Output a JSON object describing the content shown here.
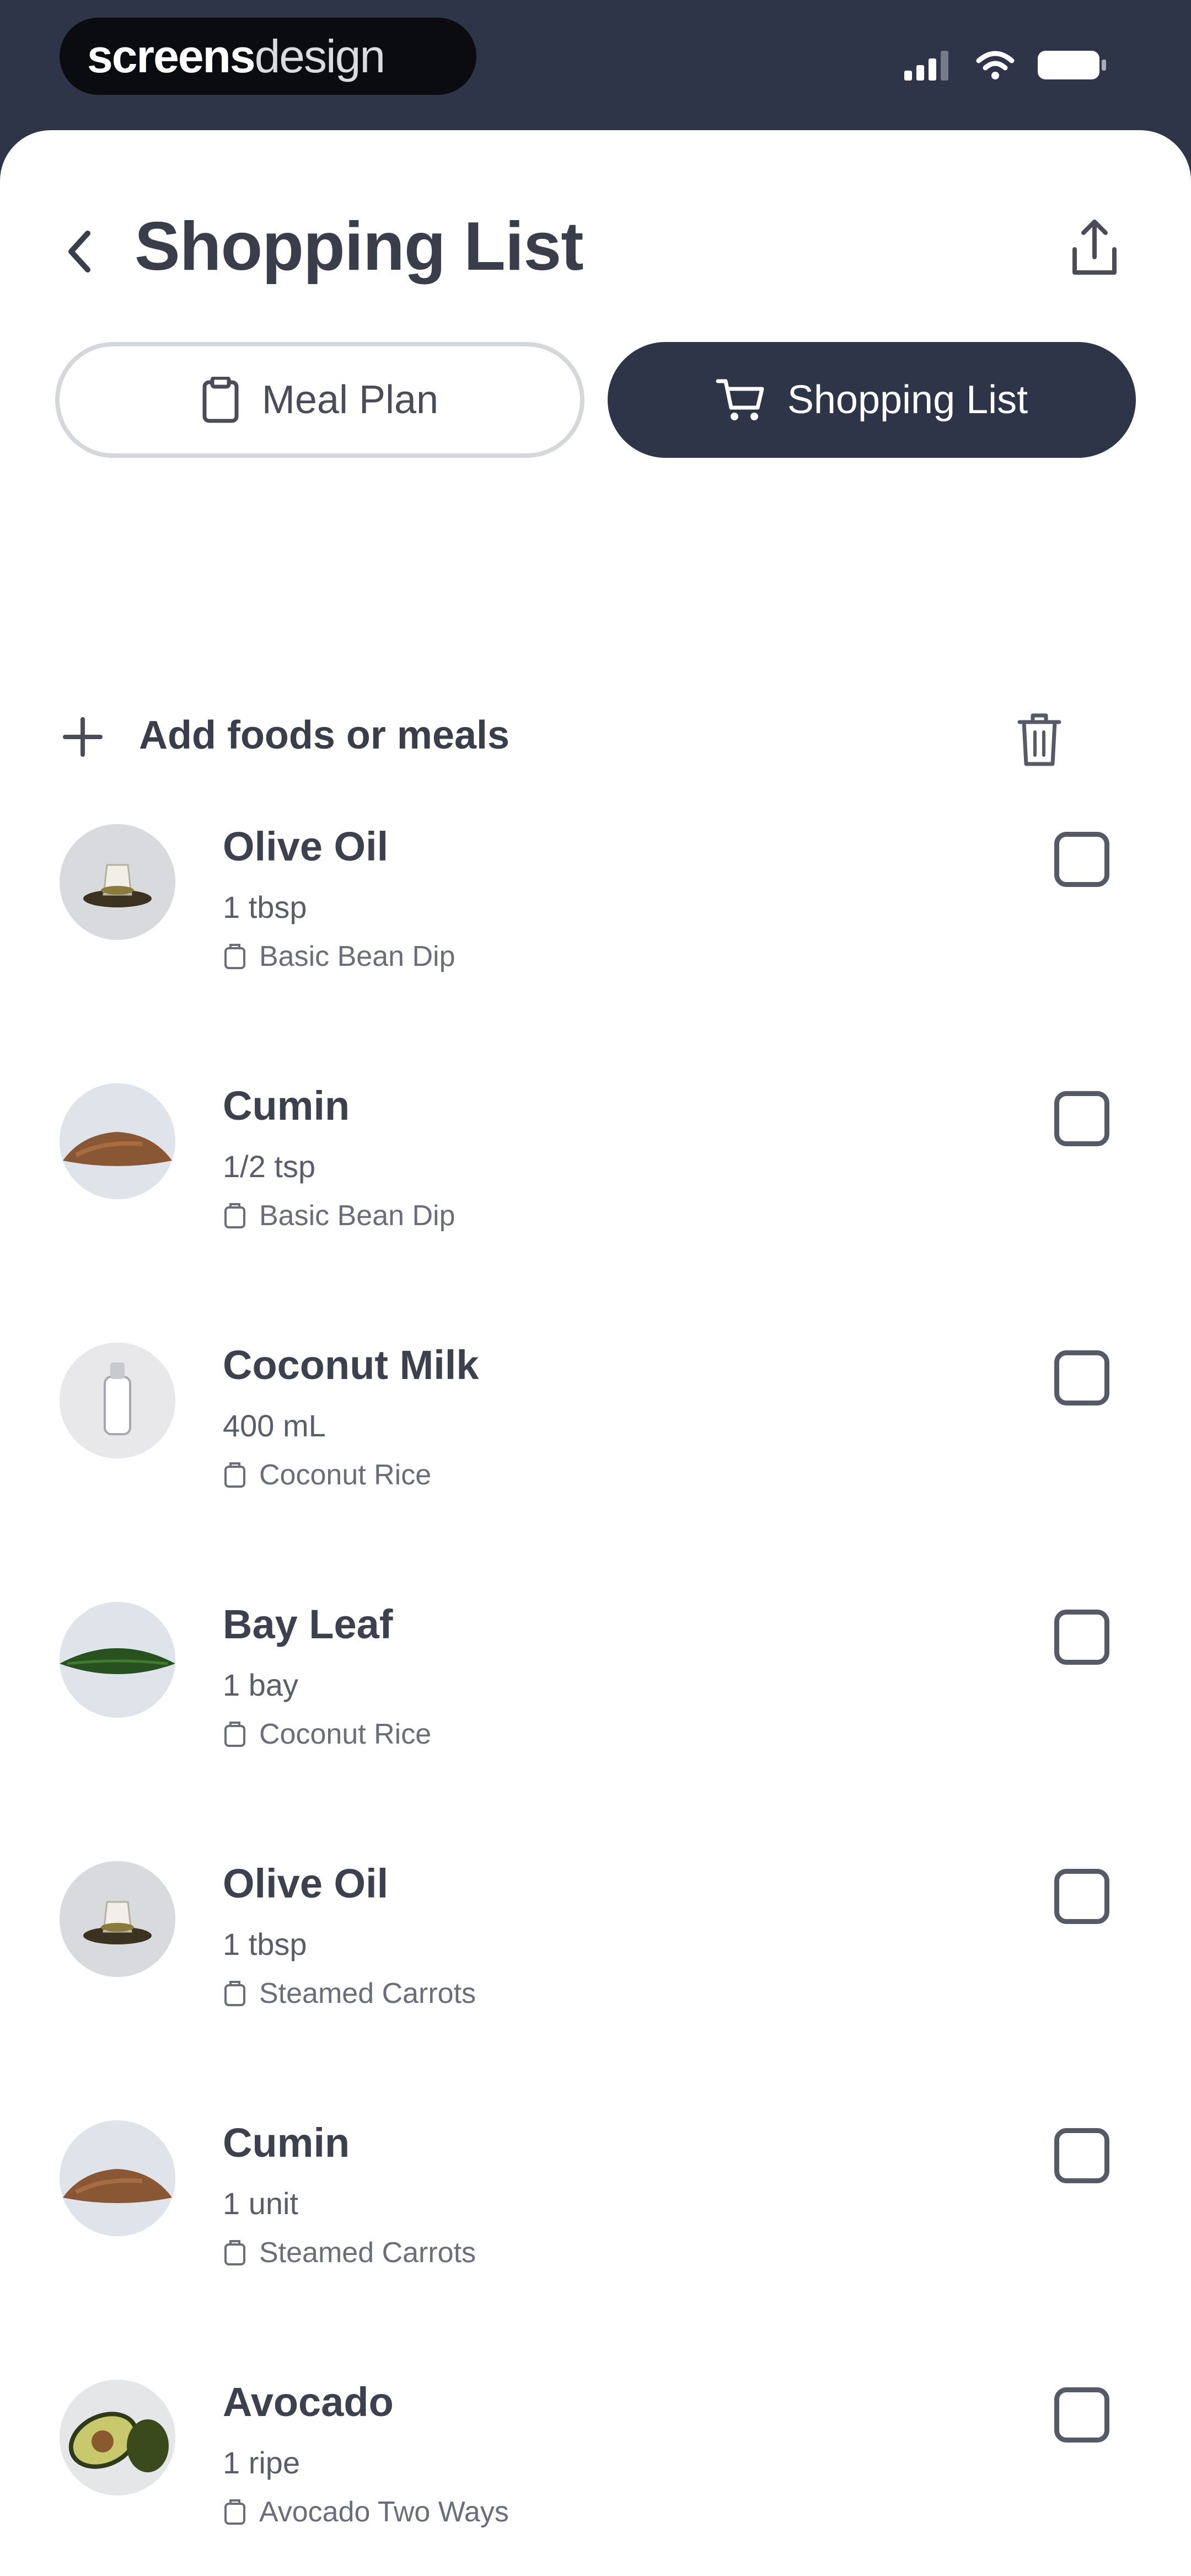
{
  "status_bar": {
    "brand_primary": "screens",
    "brand_secondary": "design",
    "icons": [
      "signal-icon",
      "wifi-icon",
      "battery-icon"
    ]
  },
  "header": {
    "title": "Shopping List",
    "back_icon": "chevron-left-icon",
    "share_icon": "share-icon"
  },
  "tabs": [
    {
      "label": "Meal Plan",
      "icon": "clipboard-icon",
      "active": false
    },
    {
      "label": "Shopping List",
      "icon": "cart-icon",
      "active": true
    }
  ],
  "add_row": {
    "label": "Add foods or meals",
    "plus_icon": "plus-icon",
    "trash_icon": "trash-icon"
  },
  "items": [
    {
      "name": "Olive Oil",
      "quantity": "1 tbsp",
      "recipe": "Basic Bean Dip",
      "image": "olive-oil",
      "checked": false
    },
    {
      "name": "Cumin",
      "quantity": "1/2 tsp",
      "recipe": "Basic Bean Dip",
      "image": "cumin",
      "checked": false
    },
    {
      "name": "Coconut Milk",
      "quantity": "400 mL",
      "recipe": "Coconut Rice",
      "image": "coconut-milk",
      "checked": false
    },
    {
      "name": "Bay Leaf",
      "quantity": "1 bay",
      "recipe": "Coconut Rice",
      "image": "bay-leaf",
      "checked": false
    },
    {
      "name": "Olive Oil",
      "quantity": "1 tbsp",
      "recipe": "Steamed Carrots",
      "image": "olive-oil",
      "checked": false
    },
    {
      "name": "Cumin",
      "quantity": "1 unit",
      "recipe": "Steamed Carrots",
      "image": "cumin",
      "checked": false
    },
    {
      "name": "Avocado",
      "quantity": "1 ripe",
      "recipe": "Avocado Two Ways",
      "image": "avocado",
      "checked": false
    }
  ],
  "colors": {
    "navy": "#2f3549",
    "text_dark": "#3a3e4a",
    "text_muted": "#6a6e79",
    "border": "#d6d7db"
  }
}
